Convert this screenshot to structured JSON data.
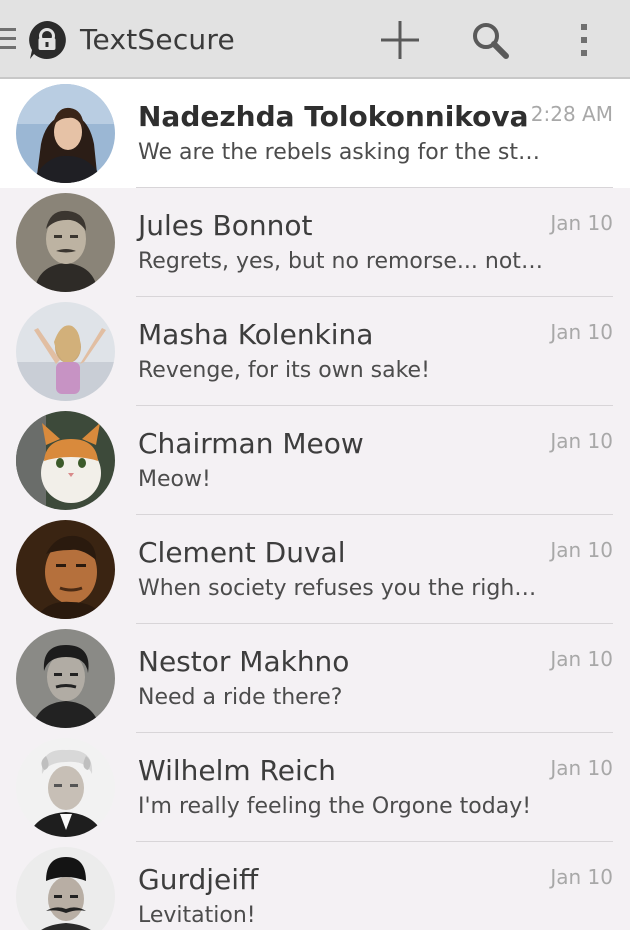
{
  "app": {
    "title": "TextSecure",
    "accent_color": "#3a3a3a"
  },
  "actionbar": {
    "icons": [
      "drawer-icon",
      "textsecure-logo-icon",
      "plus-icon",
      "search-icon",
      "overflow-menu-icon"
    ]
  },
  "conversations": [
    {
      "name": "Nadezhda Tolokonnikova",
      "snippet": "We are the rebels asking for the stor…",
      "date": "2:28 AM",
      "unread": true
    },
    {
      "name": "Jules Bonnot",
      "snippet": "Regrets, yes, but no remorse... not eve…",
      "date": "Jan 10",
      "unread": false
    },
    {
      "name": "Masha Kolenkina",
      "snippet": "Revenge, for its own sake!",
      "date": "Jan 10",
      "unread": false
    },
    {
      "name": "Chairman Meow",
      "snippet": "Meow!",
      "date": "Jan 10",
      "unread": false
    },
    {
      "name": "Clement Duval",
      "snippet": "When society refuses you the right to…",
      "date": "Jan 10",
      "unread": false
    },
    {
      "name": "Nestor Makhno",
      "snippet": "Need a ride there?",
      "date": "Jan 10",
      "unread": false
    },
    {
      "name": "Wilhelm Reich",
      "snippet": "I'm really feeling the Orgone today!",
      "date": "Jan 10",
      "unread": false
    },
    {
      "name": "Gurdjeiff",
      "snippet": "Levitation!",
      "date": "Jan 10",
      "unread": false
    }
  ]
}
